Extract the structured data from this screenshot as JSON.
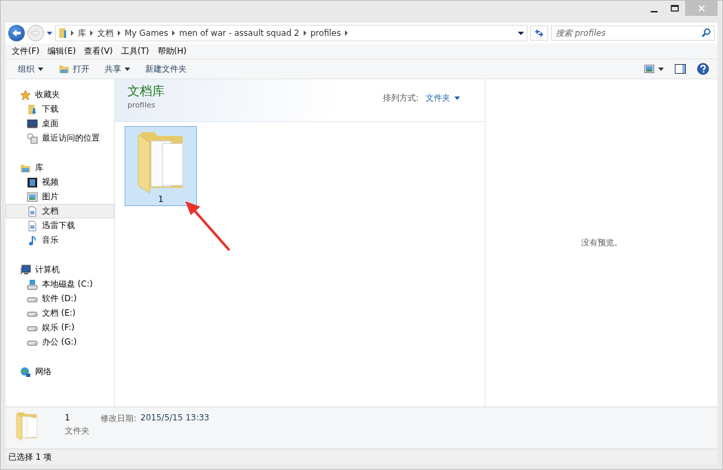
{
  "address_bar": {
    "crumbs": [
      "库",
      "文档",
      "My Games",
      "men of war - assault squad 2",
      "profiles"
    ]
  },
  "search": {
    "placeholder": "搜索 profiles"
  },
  "menu": [
    "文件(F)",
    "编辑(E)",
    "查看(V)",
    "工具(T)",
    "帮助(H)"
  ],
  "toolbar": [
    {
      "label": "组织",
      "kind": "dropdown"
    },
    {
      "label": "打开",
      "kind": "open"
    },
    {
      "label": "共享",
      "kind": "dropdown"
    },
    {
      "label": "新建文件夹",
      "kind": "plain"
    }
  ],
  "sidebar": {
    "groups": [
      {
        "label": "收藏夹",
        "kind": "star",
        "items": [
          {
            "label": "下载",
            "kind": "download-folder",
            "selected": false
          },
          {
            "label": "桌面",
            "kind": "desktop",
            "selected": false
          },
          {
            "label": "最近访问的位置",
            "kind": "recent",
            "selected": false
          }
        ]
      },
      {
        "label": "库",
        "kind": "library",
        "items": [
          {
            "label": "视频",
            "kind": "video",
            "selected": false
          },
          {
            "label": "图片",
            "kind": "picture",
            "selected": false
          },
          {
            "label": "文档",
            "kind": "document",
            "selected": true
          },
          {
            "label": "迅雷下载",
            "kind": "document",
            "selected": false
          },
          {
            "label": "音乐",
            "kind": "music",
            "selected": false
          }
        ]
      },
      {
        "label": "计算机",
        "kind": "computer",
        "items": [
          {
            "label": "本地磁盘 (C:)",
            "kind": "system-drive",
            "selected": false
          },
          {
            "label": "软件 (D:)",
            "kind": "drive",
            "selected": false
          },
          {
            "label": "文档 (E:)",
            "kind": "drive",
            "selected": false
          },
          {
            "label": "娱乐 (F:)",
            "kind": "drive",
            "selected": false
          },
          {
            "label": "办公 (G:)",
            "kind": "drive",
            "selected": false
          }
        ]
      },
      {
        "label": "网络",
        "kind": "network"
      }
    ]
  },
  "content": {
    "title": "文档库",
    "subtitle": "profiles",
    "sort_label": "排列方式:",
    "sort_value": "文件夹",
    "items": [
      {
        "name": "1",
        "selected": true
      }
    ]
  },
  "preview": {
    "message": "没有预览。"
  },
  "details": {
    "name": "1",
    "type": "文件夹",
    "modified_label": "修改日期:",
    "modified_value": "2015/5/15 13:33"
  },
  "status_bar": {
    "text": "已选择 1 项"
  }
}
